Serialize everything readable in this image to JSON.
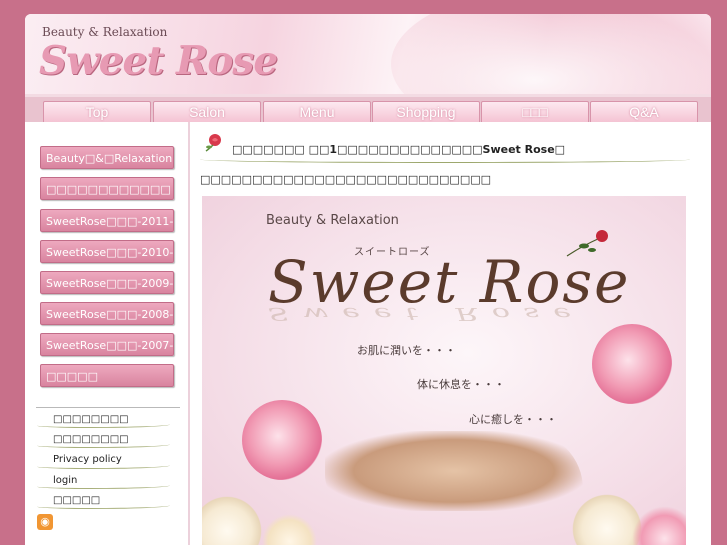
{
  "header": {
    "tagline": "Beauty & Relaxation",
    "logo": "Sweet Rose"
  },
  "nav": {
    "items": [
      {
        "label": "Top"
      },
      {
        "label": "Salon"
      },
      {
        "label": "Menu"
      },
      {
        "label": "Shopping"
      },
      {
        "label": "□□□"
      },
      {
        "label": "Q&A"
      }
    ]
  },
  "sidebar": {
    "buttons": [
      {
        "label": "Beauty□&□Relaxation"
      },
      {
        "label": "□□□□□□□□□□□□"
      },
      {
        "label": "SweetRose□□□-2011-"
      },
      {
        "label": "SweetRose□□□-2010-"
      },
      {
        "label": "SweetRose□□□-2009-"
      },
      {
        "label": "SweetRose□□□-2008-"
      },
      {
        "label": "SweetRose□□□-2007-"
      },
      {
        "label": "□□□□□"
      }
    ],
    "links": [
      {
        "label": "□□□□□□□□"
      },
      {
        "label": "□□□□□□□□"
      },
      {
        "label": "Privacy policy"
      },
      {
        "label": "login"
      },
      {
        "label": "□□□□□"
      }
    ],
    "rss_icon": "rss-icon"
  },
  "content": {
    "title": "□□□□□□□ □□1□□□□□□□□□□□□□□Sweet Rose□",
    "intro": "□□□□□□□□□□□□□□□□□□□□□□□□□□□□",
    "banner": {
      "tagline": "Beauty & Relaxation",
      "kana": "スイートローズ",
      "logo": "Sweet  Rose",
      "phrases": [
        "お肌に潤いを・・・",
        "体に休息を・・・",
        "心に癒しを・・・"
      ]
    }
  },
  "colors": {
    "background": "#c8708a",
    "accent_pink": "#e79ab3",
    "button_pink": "#d9849f",
    "nav_band": "#e9c3cf"
  }
}
